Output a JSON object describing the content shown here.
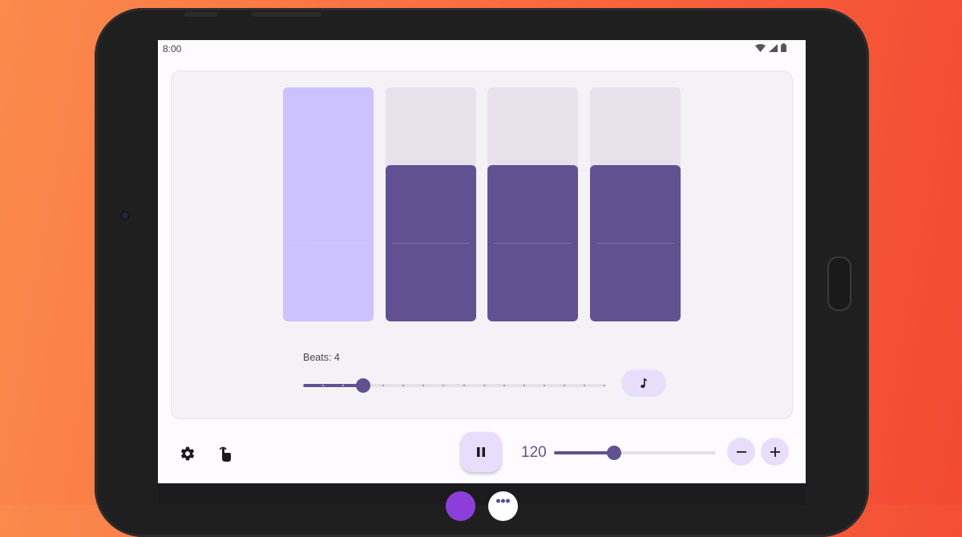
{
  "status": {
    "time": "8:00"
  },
  "beats": {
    "label": "Beats: 4",
    "count": 4,
    "value": 4,
    "min": 1,
    "max": 16,
    "cells": [
      {
        "state": "active",
        "level": 1.0
      },
      {
        "state": "normal",
        "level": 0.667
      },
      {
        "state": "normal",
        "level": 0.667
      },
      {
        "state": "normal",
        "level": 0.667
      }
    ]
  },
  "tempo": {
    "value": "120",
    "bpm": 120,
    "fraction": 0.37
  },
  "colors": {
    "accent": "#625192",
    "active_beat": "#cbc2ff",
    "inactive_bg": "#e7e2eb",
    "tonal": "#e8defc",
    "background": "#fb6a3f"
  },
  "icons": {
    "settings": "gear-icon",
    "touch": "tap-icon",
    "pause": "pause-icon",
    "minus": "minus-icon",
    "plus": "plus-icon",
    "sound": "music-note-icon",
    "wifi": "wifi-icon",
    "signal": "cell-signal-icon",
    "battery": "battery-icon"
  }
}
